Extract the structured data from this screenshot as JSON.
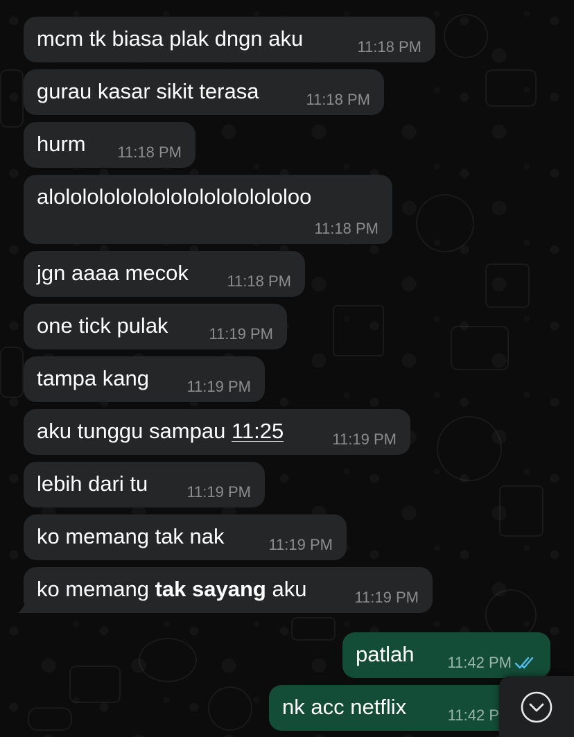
{
  "colors": {
    "incoming_bubble": "#252627",
    "outgoing_bubble": "#144d37",
    "read_ticks": "#53bdeb",
    "background": "#0c0c0c"
  },
  "messages": [
    {
      "direction": "in",
      "text": "mcm tk biasa plak dngn aku",
      "time": "11:18 PM"
    },
    {
      "direction": "in",
      "text": "gurau kasar sikit terasa",
      "time": "11:18 PM"
    },
    {
      "direction": "in",
      "text": "hurm",
      "time": "11:18 PM"
    },
    {
      "direction": "in",
      "text": "alololololololololololololololoo",
      "time": "11:18 PM"
    },
    {
      "direction": "in",
      "text": "jgn aaaa mecok",
      "time": "11:18 PM"
    },
    {
      "direction": "in",
      "text": "one tick pulak",
      "time": "11:19 PM"
    },
    {
      "direction": "in",
      "text": "tampa kang",
      "time": "11:19 PM"
    },
    {
      "direction": "in",
      "text_before": "aku tunggu sampau ",
      "text_link": "11:25",
      "time": "11:19 PM"
    },
    {
      "direction": "in",
      "text": "lebih dari tu",
      "time": "11:19 PM"
    },
    {
      "direction": "in",
      "text": "ko memang tak nak",
      "time": "11:19 PM"
    },
    {
      "direction": "in",
      "text_before": "ko memang ",
      "text_bold": "tak sayang",
      "text_after": " aku",
      "time": "11:19 PM"
    },
    {
      "direction": "out",
      "text": "patlah",
      "time": "11:42 PM",
      "status": "read"
    },
    {
      "direction": "out",
      "text": "nk acc netflix",
      "time": "11:42 P",
      "status": "read"
    }
  ],
  "scroll_button": {
    "icon": "chevron-down-icon"
  }
}
